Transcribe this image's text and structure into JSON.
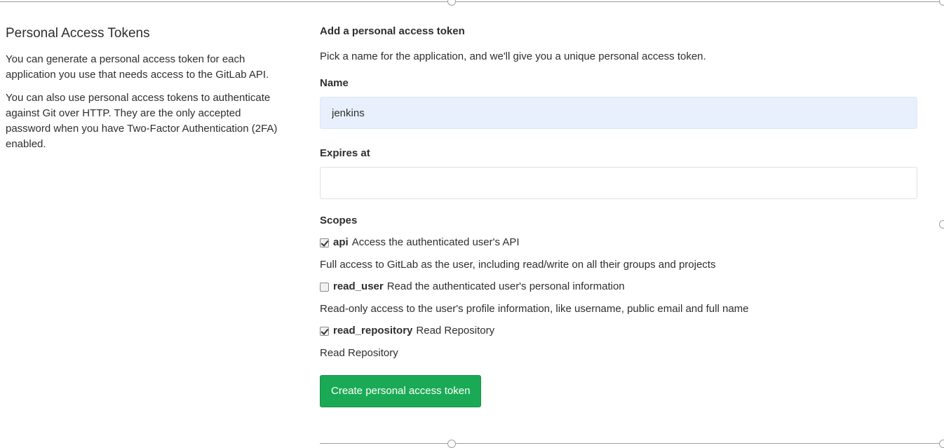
{
  "left": {
    "title": "Personal Access Tokens",
    "para1": "You can generate a personal access token for each application you use that needs access to the GitLab API.",
    "para2": "You can also use personal access tokens to authenticate against Git over HTTP. They are the only accepted password when you have Two-Factor Authentication (2FA) enabled."
  },
  "form": {
    "title": "Add a personal access token",
    "description": "Pick a name for the application, and we'll give you a unique personal access token.",
    "name_label": "Name",
    "name_value": "jenkins",
    "expires_label": "Expires at",
    "expires_value": "",
    "scopes_label": "Scopes",
    "scopes": [
      {
        "name": "api",
        "summary": "Access the authenticated user's API",
        "help": "Full access to GitLab as the user, including read/write on all their groups and projects",
        "checked": true
      },
      {
        "name": "read_user",
        "summary": "Read the authenticated user's personal information",
        "help": "Read-only access to the user's profile information, like username, public email and full name",
        "checked": false
      },
      {
        "name": "read_repository",
        "summary": "Read Repository",
        "help": "Read Repository",
        "checked": true
      }
    ],
    "submit_label": "Create personal access token",
    "submit_color": "#1aaa55",
    "name_field_bg": "#e8f0fe"
  }
}
